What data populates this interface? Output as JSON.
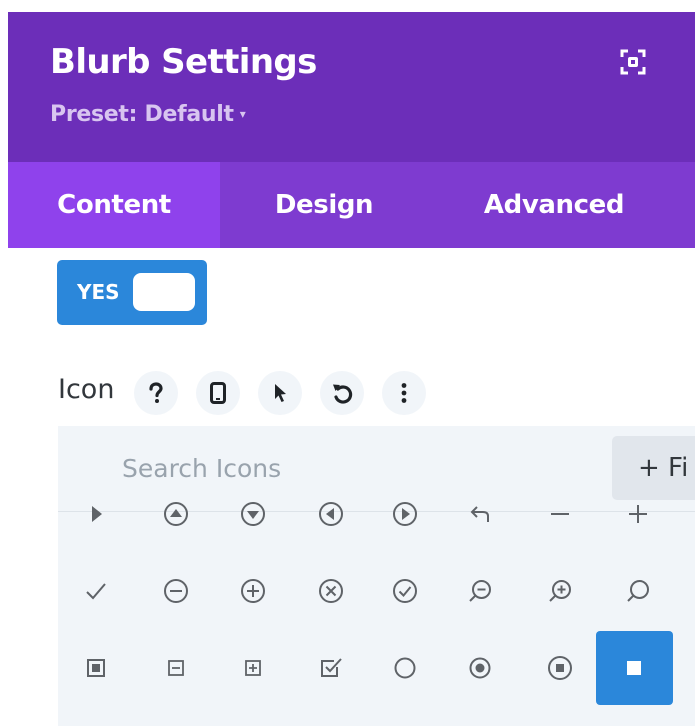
{
  "header": {
    "title": "Blurb Settings",
    "preset_label": "Preset: Default",
    "preset_caret": "▾",
    "background": "#6c2eb9"
  },
  "tabs": [
    {
      "label": "Content",
      "active": true
    },
    {
      "label": "Design",
      "active": false
    },
    {
      "label": "Advanced",
      "active": false
    }
  ],
  "toggle": {
    "label": "YES",
    "state": "on",
    "color": "#2b87da"
  },
  "icon_field": {
    "label": "Icon",
    "tools": [
      "help-icon",
      "mobile-icon",
      "cursor-icon",
      "reset-icon",
      "more-icon"
    ]
  },
  "picker": {
    "search_placeholder": "Search Icons",
    "filter_label": "+ Fi",
    "rows": [
      [
        "triangle-right-icon",
        "circle-triangle-up-icon",
        "circle-triangle-down-icon",
        "circle-triangle-left-icon",
        "circle-triangle-right-icon",
        "arrow-back-icon",
        "minus-icon",
        "plus-icon"
      ],
      [
        "check-icon",
        "circle-minus-icon",
        "circle-plus-icon",
        "circle-close-icon",
        "circle-check-icon",
        "zoom-out-icon",
        "zoom-in-icon",
        "search-icon"
      ],
      [
        "square-filled-icon",
        "square-minus-icon",
        "square-plus-icon",
        "checkbox-icon",
        "circle-outline-icon",
        "radio-selected-icon",
        "circle-stop-icon",
        "square-small-icon"
      ]
    ],
    "selected_icon": "square-small-icon",
    "accent": "#2b87da"
  }
}
